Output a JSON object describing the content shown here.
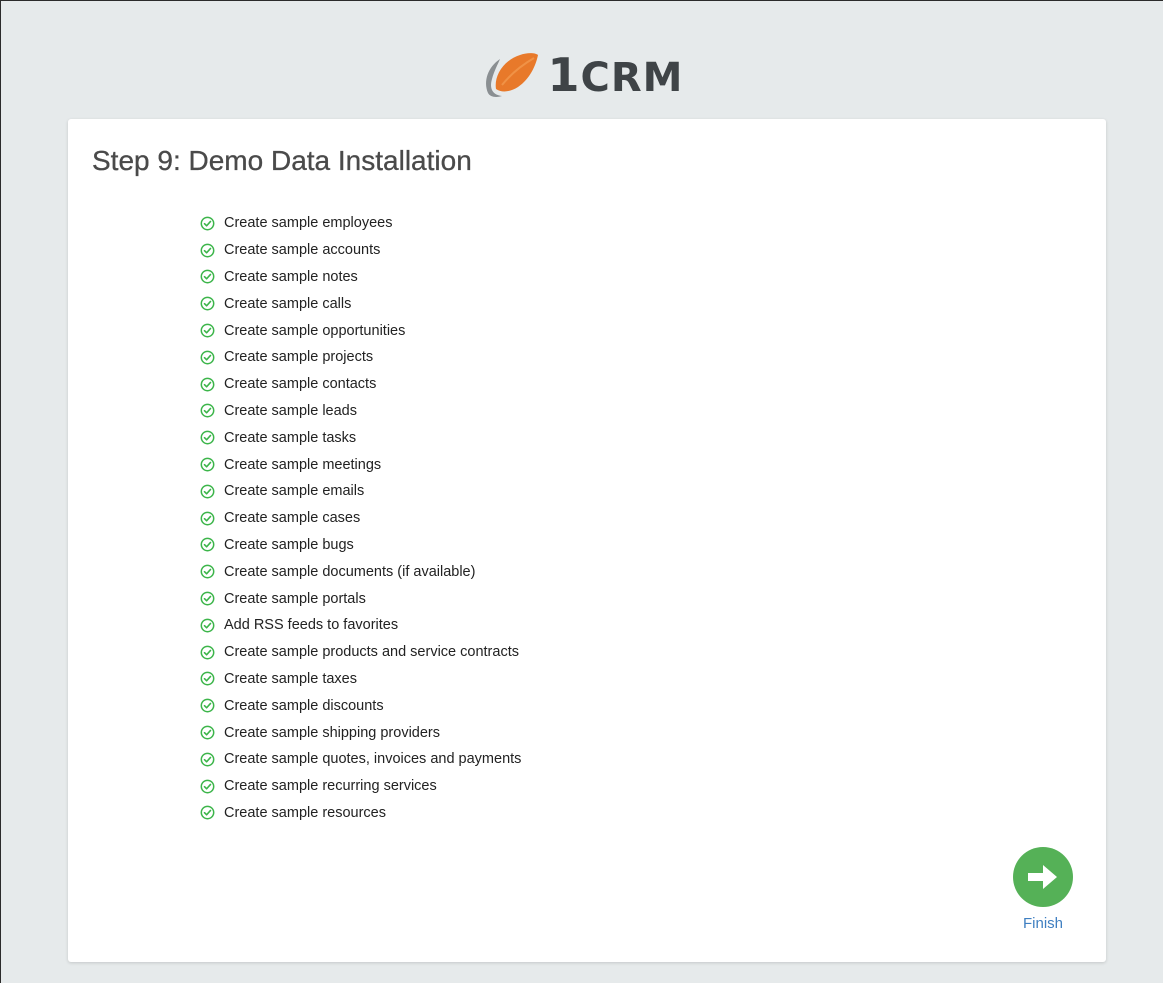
{
  "logo": {
    "number": "1",
    "text": "CRM"
  },
  "card": {
    "title": "Step 9: Demo Data Installation"
  },
  "tasks": [
    {
      "label": "Create sample employees",
      "status": "done"
    },
    {
      "label": "Create sample accounts",
      "status": "done"
    },
    {
      "label": "Create sample notes",
      "status": "done"
    },
    {
      "label": "Create sample calls",
      "status": "done"
    },
    {
      "label": "Create sample opportunities",
      "status": "done"
    },
    {
      "label": "Create sample projects",
      "status": "done"
    },
    {
      "label": "Create sample contacts",
      "status": "done"
    },
    {
      "label": "Create sample leads",
      "status": "done"
    },
    {
      "label": "Create sample tasks",
      "status": "done"
    },
    {
      "label": "Create sample meetings",
      "status": "done"
    },
    {
      "label": "Create sample emails",
      "status": "done"
    },
    {
      "label": "Create sample cases",
      "status": "done"
    },
    {
      "label": "Create sample bugs",
      "status": "done"
    },
    {
      "label": "Create sample documents (if available)",
      "status": "done"
    },
    {
      "label": "Create sample portals",
      "status": "done"
    },
    {
      "label": "Add RSS feeds to favorites",
      "status": "done"
    },
    {
      "label": "Create sample products and service contracts",
      "status": "done"
    },
    {
      "label": "Create sample taxes",
      "status": "done"
    },
    {
      "label": "Create sample discounts",
      "status": "done"
    },
    {
      "label": "Create sample shipping providers",
      "status": "done"
    },
    {
      "label": "Create sample quotes, invoices and payments",
      "status": "done"
    },
    {
      "label": "Create sample recurring services",
      "status": "done"
    },
    {
      "label": "Create sample resources",
      "status": "done"
    }
  ],
  "finish": {
    "label": "Finish",
    "icon": "arrow-right-icon"
  },
  "colors": {
    "background": "#e6eaeb",
    "card": "#ffffff",
    "check": "#3cb54a",
    "finish_button": "#55b157",
    "finish_link": "#3f7fc1",
    "logo_orange": "#e8792a",
    "logo_gray": "#3f4447"
  }
}
